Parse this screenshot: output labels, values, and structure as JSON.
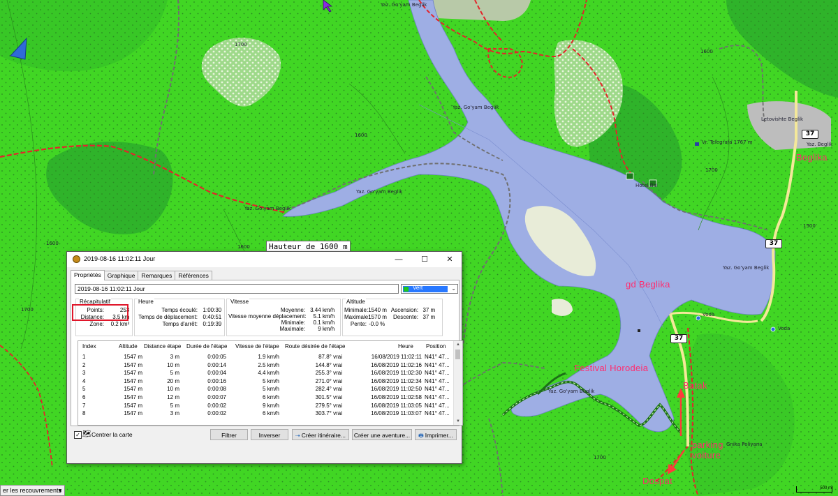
{
  "map": {
    "colors": {
      "land": "#41d624",
      "forest": "#2fb32a",
      "lake": "#9eaee4",
      "road": "#e3252b",
      "trail": "#7a7a7a"
    },
    "tooltip": "Hauteur de 1600 m",
    "labels": {
      "yaz1": "Yaz. Go'yam Beglik",
      "yaz2": "Yaz. Go'yam Beglik",
      "yaz3": "Yaz. Go'yam Beglik",
      "yaz4": "Yaz. Go'yam Beglik",
      "yaz5": "Yaz. Go'yam Beglik",
      "yaz6": "Yaz. Go'yam Beglik",
      "letovishte": "Letovishte Beglik",
      "telegrafa": "Vr. Telegrafa 1767 m",
      "hotel": "Hotel Bai",
      "voda1": "Voda",
      "voda2": "Voda",
      "poliyana": "Gnika Poliyana",
      "yaz_beglik": "Yaz. Beglik",
      "c1700a": "1700",
      "c1600a": "1600",
      "c1600b": "1600",
      "c1700b": "1700",
      "c1600c": "1600",
      "c1700c": "1700",
      "c1500": "1500",
      "c1700d": "1700",
      "c1600d": "1600"
    },
    "annotations": {
      "beglika": "Beglika",
      "gd_beglika": "gd Beglika",
      "festival": "Festival Horodeia",
      "batak": "Batak",
      "parking": "parking voiture",
      "dospat": "Dospat"
    },
    "road_shield": "37",
    "scale": "500 m",
    "overlay_select": "er les recouvrements"
  },
  "dialog": {
    "title": "2019-08-16 11:02:11 Jour",
    "window_buttons": {
      "minimize": "—",
      "maximize": "☐",
      "close": "✕"
    },
    "tabs": [
      "Propriétés",
      "Graphique",
      "Remarques",
      "Références"
    ],
    "name_value": "2019-08-16 11:02:11 Jour",
    "color_value": "Vert",
    "groups": {
      "recap": {
        "title": "Récapitulatif",
        "points_label": "Points:",
        "points_value": "253",
        "distance_label": "Distance:",
        "distance_value": "3.5 km",
        "zone_label": "Zone:",
        "zone_value": "0.2 km²"
      },
      "heure": {
        "title": "Heure",
        "ecoule_label": "Temps écoulé:",
        "ecoule_value": "1:00:30",
        "deplacement_label": "Temps de déplacement:",
        "deplacement_value": "0:40:51",
        "arret_label": "Temps d'arrêt:",
        "arret_value": "0:19:39"
      },
      "vitesse": {
        "title": "Vitesse",
        "moyenne_label": "Moyenne:",
        "moyenne_value": "3.44 km/h",
        "moy_dep_label": "Vitesse moyenne déplacement:",
        "moy_dep_value": "5.1 km/h",
        "min_label": "Minimale:",
        "min_value": "0.1 km/h",
        "max_label": "Maximale:",
        "max_value": "9 km/h"
      },
      "altitude": {
        "title": "Altitude",
        "min_label": "Minimale:",
        "min_value": "1540 m",
        "max_label": "Maximale:",
        "max_value": "1570 m",
        "pente_label": "Pente:",
        "pente_value": "-0.0 %",
        "asc_label": "Ascension:",
        "asc_value": "37 m",
        "desc_label": "Descente:",
        "desc_value": "37 m"
      }
    },
    "table": {
      "headers": [
        "Index",
        "Altitude",
        "Distance étape",
        "Durée de l'étape",
        "Vitesse de l'étape",
        "Route désirée de l'étape",
        "Heure",
        "Position"
      ],
      "rows": [
        [
          "1",
          "1547 m",
          "3 m",
          "0:00:05",
          "1.9 km/h",
          "87.8° vrai",
          "16/08/2019 11:02:11",
          "N41° 47..."
        ],
        [
          "2",
          "1547 m",
          "10 m",
          "0:00:14",
          "2.5 km/h",
          "144.8° vrai",
          "16/08/2019 11:02:16",
          "N41° 47..."
        ],
        [
          "3",
          "1547 m",
          "5 m",
          "0:00:04",
          "4.4 km/h",
          "255.3° vrai",
          "16/08/2019 11:02:30",
          "N41° 47..."
        ],
        [
          "4",
          "1547 m",
          "20 m",
          "0:00:16",
          "5 km/h",
          "271.0° vrai",
          "16/08/2019 11:02:34",
          "N41° 47..."
        ],
        [
          "5",
          "1547 m",
          "10 m",
          "0:00:08",
          "5 km/h",
          "282.4° vrai",
          "16/08/2019 11:02:50",
          "N41° 47..."
        ],
        [
          "6",
          "1547 m",
          "12 m",
          "0:00:07",
          "6 km/h",
          "301.5° vrai",
          "16/08/2019 11:02:58",
          "N41° 47..."
        ],
        [
          "7",
          "1547 m",
          "5 m",
          "0:00:02",
          "9 km/h",
          "279.5° vrai",
          "16/08/2019 11:03:05",
          "N41° 47..."
        ],
        [
          "8",
          "1547 m",
          "3 m",
          "0:00:02",
          "6 km/h",
          "303.7° vrai",
          "16/08/2019 11:03:07",
          "N41° 47..."
        ]
      ]
    },
    "center_map_label": "Centrer la carte",
    "buttons": {
      "filtrer": "Filtrer",
      "inverser": "Inverser",
      "itineraire": "Créer itinéraire...",
      "aventure": "Créer une aventure...",
      "imprimer": "Imprimer..."
    }
  }
}
